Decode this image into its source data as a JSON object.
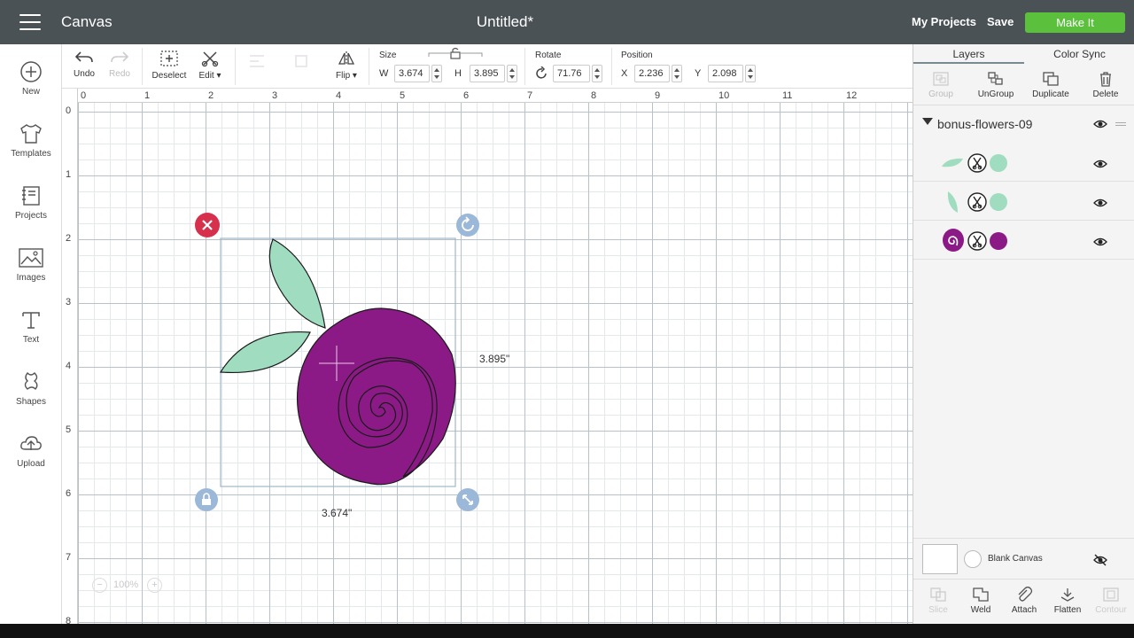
{
  "header": {
    "app_title": "Canvas",
    "doc_title": "Untitled*",
    "my_projects": "My Projects",
    "save": "Save",
    "make_it": "Make It"
  },
  "sidebar": {
    "items": [
      {
        "label": "New",
        "icon": "plus-circle-icon"
      },
      {
        "label": "Templates",
        "icon": "tshirt-icon"
      },
      {
        "label": "Projects",
        "icon": "projects-icon"
      },
      {
        "label": "Images",
        "icon": "image-icon"
      },
      {
        "label": "Text",
        "icon": "text-icon"
      },
      {
        "label": "Shapes",
        "icon": "shapes-icon"
      },
      {
        "label": "Upload",
        "icon": "upload-cloud-icon"
      }
    ]
  },
  "toolbar": {
    "undo": "Undo",
    "redo": "Redo",
    "deselect": "Deselect",
    "edit": "Edit",
    "flip": "Flip",
    "size_label": "Size",
    "w_label": "W",
    "w_value": "3.674",
    "h_label": "H",
    "h_value": "3.895",
    "rotate_label": "Rotate",
    "rotate_value": "71.76",
    "position_label": "Position",
    "x_label": "X",
    "x_value": "2.236",
    "y_label": "Y",
    "y_value": "2.098"
  },
  "canvas": {
    "ruler_top": [
      "0",
      "1",
      "2",
      "3",
      "4",
      "5",
      "6",
      "7",
      "8",
      "9",
      "10",
      "11",
      "12"
    ],
    "ruler_left": [
      "0",
      "1",
      "2",
      "3",
      "4",
      "5",
      "6",
      "7",
      "8"
    ],
    "width_dim": "3.674\"",
    "height_dim": "3.895\"",
    "zoom": "100%",
    "colors": {
      "leaf": "#9fdcc0",
      "flower": "#8c1a86",
      "delete": "#d6304d",
      "handle": "#9bb8d8"
    }
  },
  "layers_panel": {
    "tabs": [
      "Layers",
      "Color Sync"
    ],
    "tools": {
      "group": "Group",
      "ungroup": "UnGroup",
      "duplicate": "Duplicate",
      "delete": "Delete"
    },
    "group_name": "bonus-flowers-09",
    "layers": [
      {
        "thumb": "leaf-horizontal",
        "color": "#9fdcc0"
      },
      {
        "thumb": "leaf-vertical",
        "color": "#9fdcc0"
      },
      {
        "thumb": "flower",
        "color": "#8c1a86"
      }
    ],
    "blank_canvas": "Blank Canvas",
    "bottom_tools": {
      "slice": "Slice",
      "weld": "Weld",
      "attach": "Attach",
      "flatten": "Flatten",
      "contour": "Contour"
    }
  }
}
